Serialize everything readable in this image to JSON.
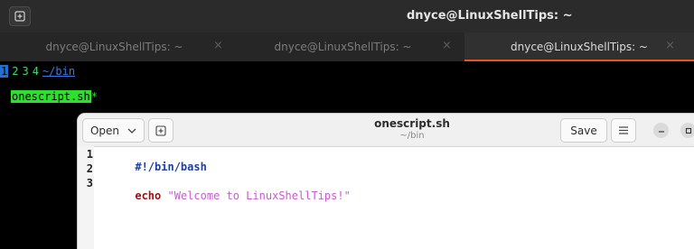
{
  "terminal": {
    "title": "dnyce@LinuxShellTips: ~",
    "tabs": [
      {
        "label": "dnyce@LinuxShellTips: ~",
        "close": "×",
        "active": false
      },
      {
        "label": "dnyce@LinuxShellTips: ~",
        "close": "×",
        "active": false
      },
      {
        "label": "dnyce@LinuxShellTips: ~",
        "close": "×",
        "active": true
      }
    ],
    "statusbar": {
      "workspaces": [
        "1",
        "2",
        "3",
        "4"
      ],
      "active_workspace": "1",
      "path": "~/bin"
    },
    "file": {
      "name": "onescript.sh",
      "modified_marker": "*"
    }
  },
  "gedit": {
    "open_label": "Open",
    "title": "onescript.sh",
    "subtitle": "~/bin",
    "save_label": "Save",
    "lines": [
      {
        "number": "1",
        "segments": [
          {
            "text": "#!/bin/bash",
            "style": "shebang"
          }
        ]
      },
      {
        "number": "2",
        "segments": []
      },
      {
        "number": "3",
        "segments": [
          {
            "text": "echo",
            "style": "kw"
          },
          {
            "text": " ",
            "style": "plain"
          },
          {
            "text": "\"Welcome to LinuxShellTips!\"",
            "style": "str"
          }
        ]
      }
    ]
  },
  "colors": {
    "tab_accent": "#e95420",
    "file_highlight": "#2de02d",
    "workspace_active": "#1e72d6",
    "path_link": "#3d78e0"
  },
  "icons": {
    "new_tab": "new-tab-icon",
    "open_chevron": "chevron-down-icon",
    "new_document": "new-document-icon",
    "menu": "hamburger-menu-icon",
    "minimize": "minimize-icon",
    "maximize": "maximize-icon"
  }
}
